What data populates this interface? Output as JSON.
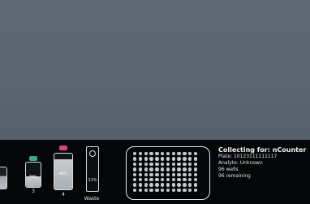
{
  "bottles": [
    {
      "number": "3",
      "fill_label": "50%",
      "fill_fraction": 0.45,
      "cap_color": "#3fa886"
    },
    {
      "number": "4",
      "fill_label": "95%",
      "fill_fraction": 0.85,
      "cap_color": "#d9457a"
    }
  ],
  "waste": {
    "label": "Waste",
    "percent_label": "11%"
  },
  "plate": {
    "wells": 96
  },
  "info": {
    "title": "Collecting for: nCounter",
    "plate_line": "Plate: 10123111111117",
    "analyte_line": "Analyte: Unknown",
    "wells_line": "96 wells",
    "remaining_line": "96 remaining"
  }
}
